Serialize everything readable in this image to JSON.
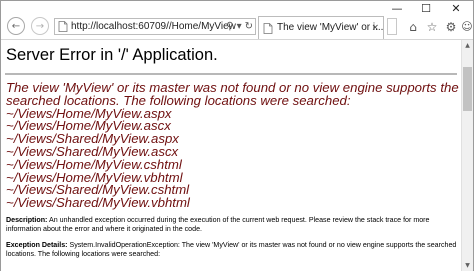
{
  "window": {
    "minimize_glyph": "—",
    "maximize_glyph": "☐",
    "close_glyph": "✕"
  },
  "toolbar": {
    "back_glyph": "←",
    "forward_glyph": "→",
    "url": "http://localhost:60709//Home/MyView",
    "address_icons": [
      "search-icon",
      "dropdown-icon",
      "refresh-icon"
    ],
    "search_glyph": "⚲",
    "dropdown_glyph": "▾",
    "refresh_glyph": "↻",
    "tab_title": "The view 'MyView' or i...",
    "tab_close_glyph": "×",
    "home_glyph": "⌂",
    "star_glyph": "☆",
    "gear_glyph": "⚙",
    "smile_glyph": "☺"
  },
  "page": {
    "title": "Server Error in '/' Application.",
    "error_lines": [
      "The view 'MyView' or its master was not found or no view engine supports the",
      "searched locations. The following locations were searched:",
      "~/Views/Home/MyView.aspx",
      "~/Views/Home/MyView.ascx",
      "~/Views/Shared/MyView.aspx",
      "~/Views/Shared/MyView.ascx",
      "~/Views/Home/MyView.cshtml",
      "~/Views/Home/MyView.vbhtml",
      "~/Views/Shared/MyView.cshtml",
      "~/Views/Shared/MyView.vbhtml"
    ],
    "description_label": "Description:",
    "description_text": " An unhandled exception occurred during the execution of the current web request. Please review the stack trace for more information about the error and where it originated in the code.",
    "exception_label": "Exception Details:",
    "exception_text": " System.InvalidOperationException: The view 'MyView' or its master was not found or no view engine supports the searched locations. The following locations were searched:"
  },
  "scrollbar": {
    "up_glyph": "▲",
    "down_glyph": "▼",
    "position": 0.08
  }
}
